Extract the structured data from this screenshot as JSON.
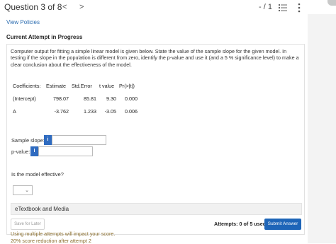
{
  "header": {
    "question_label": "Question 3 of 8",
    "prev_icon": "chevron-left-icon",
    "prev_glyph": "<",
    "next_icon": "chevron-right-icon",
    "next_glyph": ">",
    "page_count": "- / 1",
    "list_icon": "list-icon",
    "more_icon": "more-vertical-icon"
  },
  "links": {
    "view_policies": "View Policies"
  },
  "attempt": {
    "title": "Current Attempt in Progress"
  },
  "question": {
    "text": "Computer output for fitting a simple linear model is given below. State the value of the sample slope for the given model. In testing if the slope in the population is different from zero, identify the p-value and use it (and a 5 % significance level) to make a clear conclusion about the effectiveness of the model."
  },
  "table": {
    "headers": [
      "Coefficients:",
      "Estimate",
      "Std.Error",
      "t value",
      "Pr(>|t|)"
    ],
    "rows": [
      [
        "(Intercept)",
        "798.07",
        "85.81",
        "9.30",
        "0.000"
      ],
      [
        "A",
        "-3.762",
        "1.233",
        "-3.05",
        "0.006"
      ]
    ]
  },
  "inputs": {
    "slope_label": "Sample slope:",
    "pvalue_label": "p-value:",
    "info_glyph": "i",
    "slope_value": "",
    "pvalue_value": ""
  },
  "effective": {
    "question": "Is the model effective?",
    "selected": "",
    "dropdown_glyph": "⌄"
  },
  "etextbook": {
    "label": "eTextbook and Media"
  },
  "footer": {
    "save_label": "Save for Later",
    "attempts_text": "Attempts: 0 of 5 used",
    "submit_label": "Submit Answer",
    "warning_line1": "Using multiple attempts will impact your score.",
    "warning_line2": "20% score reduction after attempt 2"
  },
  "colors": {
    "accent": "#1e65b8",
    "link": "#2b6cb0",
    "warning": "#8a6d2b"
  }
}
